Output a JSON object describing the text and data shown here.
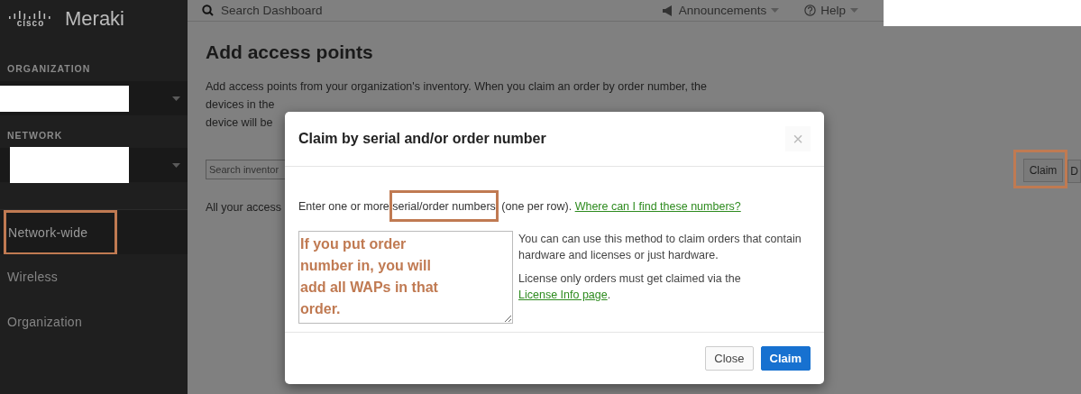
{
  "logo": {
    "brand": "cisco",
    "product": "Meraki"
  },
  "top_bar": {
    "search": {
      "placeholder": "Search Dashboard"
    },
    "menus": [
      {
        "label": "Announcements",
        "kind": "announce"
      },
      {
        "label": "Help",
        "kind": "help"
      }
    ]
  },
  "sidebar": {
    "selectors": [
      {
        "heading": "ORGANIZATION"
      },
      {
        "heading": "NETWORK"
      }
    ],
    "items": [
      {
        "label": "Network-wide",
        "selected": true,
        "highlighted": true
      },
      {
        "label": "Wireless",
        "selected": false,
        "highlighted": false
      },
      {
        "label": "Organization",
        "selected": false,
        "highlighted": false
      }
    ]
  },
  "page": {
    "title": "Add access points",
    "intro": [
      "Add access points from your organization's inventory. When you claim an order by order number, the",
      "devices in the",
      "device will be"
    ],
    "search": {
      "placeholder": "Search inventor"
    },
    "buttons": [
      {
        "label": "Claim",
        "highlighted": true
      },
      {
        "label": "D",
        "highlighted": false
      }
    ],
    "note": "All your access"
  },
  "modal": {
    "title": "Claim by serial and/or order number",
    "close": "×",
    "instruction": {
      "prefix": "Enter one or more ",
      "highlight": "serial/order numbers",
      "suffix": " (one per row). ",
      "link": "Where can I find these numbers?"
    },
    "annotation": "If you put order number in, you will add all WAPs in that order.",
    "help": [
      {
        "text": "You can can use this method to claim orders that contain hardware and licenses or just hardware."
      },
      {
        "text": "License only orders must get claimed via the ",
        "link": "License Info page",
        "after": "."
      }
    ],
    "buttons": [
      {
        "label": "Close",
        "kind": "secondary"
      },
      {
        "label": "Claim",
        "kind": "primary"
      }
    ]
  }
}
